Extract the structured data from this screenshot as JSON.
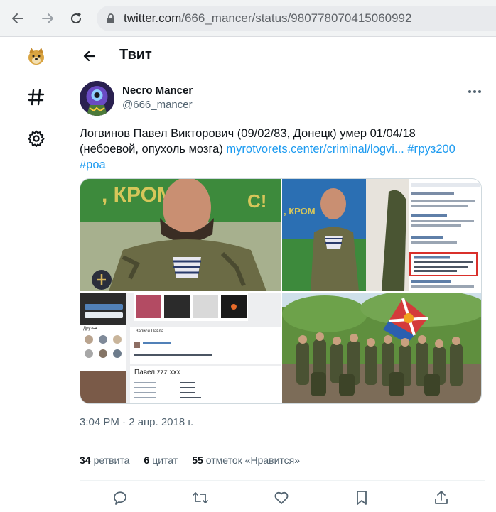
{
  "browser": {
    "url_host": "twitter.com",
    "url_path": "/666_mancer/status/980778070415060992"
  },
  "rail": {
    "items": [
      {
        "icon": "doge-logo-icon"
      },
      {
        "icon": "hashtag-icon"
      },
      {
        "icon": "gear-icon"
      }
    ]
  },
  "header": {
    "title": "Твит"
  },
  "tweet": {
    "author_name": "Necro Mancer",
    "author_handle": "@666_mancer",
    "text_line1": "Логвинов Павел Викторович (09/02/83, Донецк) умер 01/04/18",
    "text_line2_plain": "(небоевой, опухоль мозга) ",
    "link": "myrotvorets.center/criminal/logvi...",
    "hashtag1": "#груз200",
    "hashtag2": "#роа",
    "timestamp": "3:04 PM · 2 апр. 2018 г.",
    "retweets_count": "34",
    "retweets_label": "ретвита",
    "quotes_count": "6",
    "quotes_label": "цитат",
    "likes_count": "55",
    "likes_label": "отметок «Нравится»"
  },
  "media": {
    "profile_page_name": "Павел zzz xxx",
    "profile_posts_header": "Записи Павла",
    "comment_author": "Артем Кравчук",
    "comment_text": "Опухоль головного мозга с инфекцией и последующим кровоизлиянием.",
    "friends_label": "Друзья"
  },
  "colors": {
    "accent": "#1d9bf0",
    "text_secondary": "#536471",
    "flag_green": "#3d8a3c",
    "uniform": "#6b6b45"
  }
}
